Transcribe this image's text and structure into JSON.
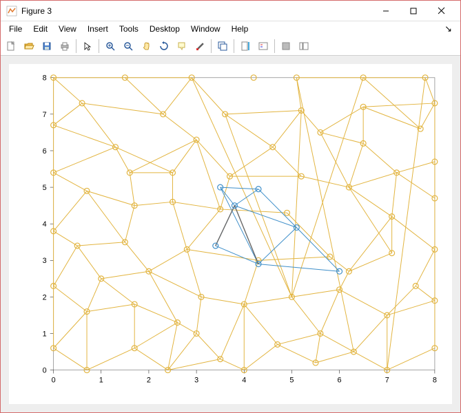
{
  "window": {
    "title": "Figure 3"
  },
  "menu": {
    "file": "File",
    "edit": "Edit",
    "view": "View",
    "insert": "Insert",
    "tools": "Tools",
    "desktop": "Desktop",
    "window": "Window",
    "help": "Help"
  },
  "chart_data": {
    "type": "scatter",
    "xlabel": "",
    "ylabel": "",
    "xlim": [
      0,
      8
    ],
    "ylim": [
      0,
      8
    ],
    "xticks": [
      0,
      1,
      2,
      3,
      4,
      5,
      6,
      7,
      8
    ],
    "yticks": [
      0,
      1,
      2,
      3,
      4,
      5,
      6,
      7,
      8
    ],
    "nodes_gold": [
      [
        0,
        0.6
      ],
      [
        0,
        2.3
      ],
      [
        0,
        3.8
      ],
      [
        0,
        5.4
      ],
      [
        0,
        6.7
      ],
      [
        0,
        8
      ],
      [
        0.7,
        0
      ],
      [
        0.7,
        1.6
      ],
      [
        0.5,
        3.4
      ],
      [
        0.7,
        4.9
      ],
      [
        0.6,
        7.3
      ],
      [
        1.0,
        2.5
      ],
      [
        1.3,
        6.1
      ],
      [
        1.5,
        8
      ],
      [
        1.7,
        0.6
      ],
      [
        1.7,
        1.8
      ],
      [
        1.5,
        3.5
      ],
      [
        1.7,
        4.5
      ],
      [
        1.6,
        5.4
      ],
      [
        2.0,
        2.7
      ],
      [
        2.3,
        7.0
      ],
      [
        2.4,
        0
      ],
      [
        2.6,
        1.3
      ],
      [
        2.5,
        4.6
      ],
      [
        2.5,
        5.4
      ],
      [
        2.8,
        3.3
      ],
      [
        2.9,
        8
      ],
      [
        3.0,
        6.3
      ],
      [
        3.1,
        2.0
      ],
      [
        3.0,
        1.0
      ],
      [
        3.5,
        0.3
      ],
      [
        3.5,
        4.4
      ],
      [
        3.6,
        7.0
      ],
      [
        3.7,
        5.3
      ],
      [
        4.0,
        0
      ],
      [
        4.0,
        1.8
      ],
      [
        4.3,
        3.0
      ],
      [
        4.2,
        8
      ],
      [
        4.6,
        6.1
      ],
      [
        4.7,
        0.7
      ],
      [
        4.9,
        4.3
      ],
      [
        5.0,
        2.0
      ],
      [
        5.1,
        8
      ],
      [
        5.2,
        5.3
      ],
      [
        5.2,
        7.1
      ],
      [
        5.5,
        0.2
      ],
      [
        5.6,
        1.0
      ],
      [
        5.6,
        6.5
      ],
      [
        5.8,
        3.1
      ],
      [
        6.0,
        2.2
      ],
      [
        6.2,
        2.7
      ],
      [
        6.2,
        5.0
      ],
      [
        6.3,
        0.5
      ],
      [
        6.5,
        8
      ],
      [
        6.5,
        6.2
      ],
      [
        6.5,
        7.2
      ],
      [
        7.0,
        0
      ],
      [
        7.0,
        1.5
      ],
      [
        7.1,
        3.2
      ],
      [
        7.1,
        4.2
      ],
      [
        7.2,
        5.4
      ],
      [
        7.6,
        2.3
      ],
      [
        7.7,
        6.6
      ],
      [
        7.8,
        8
      ],
      [
        8,
        0.6
      ],
      [
        8,
        1.9
      ],
      [
        8,
        3.3
      ],
      [
        8,
        4.7
      ],
      [
        8,
        5.7
      ],
      [
        8,
        7.3
      ]
    ],
    "edges_gold": [
      [
        0,
        1
      ],
      [
        1,
        2
      ],
      [
        2,
        3
      ],
      [
        3,
        4
      ],
      [
        4,
        5
      ],
      [
        0,
        6
      ],
      [
        0,
        7
      ],
      [
        1,
        7
      ],
      [
        1,
        8
      ],
      [
        2,
        8
      ],
      [
        2,
        9
      ],
      [
        3,
        9
      ],
      [
        3,
        12
      ],
      [
        4,
        12
      ],
      [
        4,
        10
      ],
      [
        5,
        10
      ],
      [
        5,
        13
      ],
      [
        6,
        7
      ],
      [
        7,
        11
      ],
      [
        8,
        11
      ],
      [
        8,
        16
      ],
      [
        9,
        16
      ],
      [
        9,
        17
      ],
      [
        12,
        18
      ],
      [
        10,
        12
      ],
      [
        10,
        20
      ],
      [
        13,
        20
      ],
      [
        13,
        26
      ],
      [
        7,
        15
      ],
      [
        11,
        15
      ],
      [
        11,
        19
      ],
      [
        16,
        19
      ],
      [
        16,
        17
      ],
      [
        17,
        18
      ],
      [
        18,
        24
      ],
      [
        12,
        24
      ],
      [
        6,
        14
      ],
      [
        14,
        15
      ],
      [
        15,
        22
      ],
      [
        14,
        22
      ],
      [
        14,
        21
      ],
      [
        21,
        22
      ],
      [
        19,
        22
      ],
      [
        19,
        28
      ],
      [
        19,
        25
      ],
      [
        25,
        28
      ],
      [
        17,
        23
      ],
      [
        23,
        24
      ],
      [
        23,
        25
      ],
      [
        24,
        27
      ],
      [
        18,
        27
      ],
      [
        20,
        27
      ],
      [
        20,
        26
      ],
      [
        26,
        32
      ],
      [
        21,
        29
      ],
      [
        22,
        29
      ],
      [
        28,
        29
      ],
      [
        29,
        30
      ],
      [
        21,
        30
      ],
      [
        30,
        34
      ],
      [
        25,
        31
      ],
      [
        23,
        31
      ],
      [
        27,
        31
      ],
      [
        31,
        33
      ],
      [
        27,
        33
      ],
      [
        33,
        38
      ],
      [
        32,
        38
      ],
      [
        26,
        41
      ],
      [
        32,
        44
      ],
      [
        28,
        35
      ],
      [
        30,
        35
      ],
      [
        34,
        35
      ],
      [
        35,
        36
      ],
      [
        25,
        36
      ],
      [
        34,
        39
      ],
      [
        35,
        39
      ],
      [
        31,
        40
      ],
      [
        33,
        43
      ],
      [
        38,
        43
      ],
      [
        38,
        44
      ],
      [
        41,
        44
      ],
      [
        32,
        41
      ],
      [
        41,
        53
      ],
      [
        39,
        45
      ],
      [
        39,
        46
      ],
      [
        35,
        41
      ],
      [
        41,
        46
      ],
      [
        41,
        49
      ],
      [
        36,
        48
      ],
      [
        40,
        48
      ],
      [
        43,
        51
      ],
      [
        44,
        47
      ],
      [
        47,
        54
      ],
      [
        45,
        46
      ],
      [
        46,
        49
      ],
      [
        49,
        50
      ],
      [
        48,
        50
      ],
      [
        50,
        58
      ],
      [
        51,
        58
      ],
      [
        51,
        54
      ],
      [
        47,
        51
      ],
      [
        47,
        55
      ],
      [
        54,
        55
      ],
      [
        44,
        42
      ],
      [
        42,
        52
      ],
      [
        42,
        53
      ],
      [
        53,
        62
      ],
      [
        53,
        63
      ],
      [
        55,
        62
      ],
      [
        55,
        69
      ],
      [
        45,
        52
      ],
      [
        46,
        52
      ],
      [
        49,
        57
      ],
      [
        52,
        57
      ],
      [
        52,
        56
      ],
      [
        56,
        57
      ],
      [
        56,
        64
      ],
      [
        57,
        61
      ],
      [
        50,
        59
      ],
      [
        58,
        59
      ],
      [
        59,
        66
      ],
      [
        51,
        59
      ],
      [
        51,
        60
      ],
      [
        59,
        60
      ],
      [
        54,
        60
      ],
      [
        60,
        68
      ],
      [
        57,
        65
      ],
      [
        61,
        65
      ],
      [
        61,
        66
      ],
      [
        64,
        65
      ],
      [
        65,
        66
      ],
      [
        66,
        67
      ],
      [
        60,
        67
      ],
      [
        67,
        68
      ],
      [
        68,
        69
      ],
      [
        62,
        69
      ],
      [
        63,
        69
      ],
      [
        56,
        63
      ]
    ],
    "nodes_blue": [
      [
        3.5,
        5.0
      ],
      [
        3.8,
        4.5
      ],
      [
        3.4,
        3.4
      ],
      [
        4.3,
        2.9
      ],
      [
        4.3,
        4.95
      ],
      [
        5.1,
        3.9
      ],
      [
        6.0,
        2.7
      ]
    ],
    "edges_blue": [
      [
        0,
        1
      ],
      [
        1,
        2
      ],
      [
        2,
        3
      ],
      [
        0,
        4
      ],
      [
        1,
        4
      ],
      [
        4,
        5
      ],
      [
        3,
        5
      ],
      [
        3,
        6
      ],
      [
        5,
        6
      ],
      [
        1,
        5
      ],
      [
        0,
        3
      ]
    ],
    "edges_gray": [
      [
        1,
        3
      ],
      [
        2,
        1
      ]
    ]
  }
}
